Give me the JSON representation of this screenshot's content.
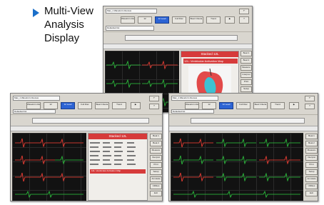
{
  "caption": {
    "line1": "Multi-View",
    "line2": "Analysis",
    "line3": "Display",
    "bullet_color": "#1b6fc9"
  },
  "screens": {
    "common": {
      "title": "Mac_1  Waveform Review",
      "patient_field": "Defaulted list",
      "toolbar": [
        "Waveform Review",
        "12",
        "12 Lead",
        "Full Disc",
        "Beat Criteria",
        "Trend",
        "▶"
      ],
      "side_buttons": [
        "Beat 1",
        "Beat 2",
        "Measure",
        "Interpret",
        "Print",
        "Setup",
        "Annotate",
        "Utilities",
        "Exit"
      ]
    },
    "top": {
      "panel_title": "Stacked 12L",
      "panel_subtitle": "12L: Ventricular Activation Map"
    },
    "left": {
      "panel_title": "Stacked 12L",
      "red_label": "12L: Ventricular Activation Map"
    }
  }
}
